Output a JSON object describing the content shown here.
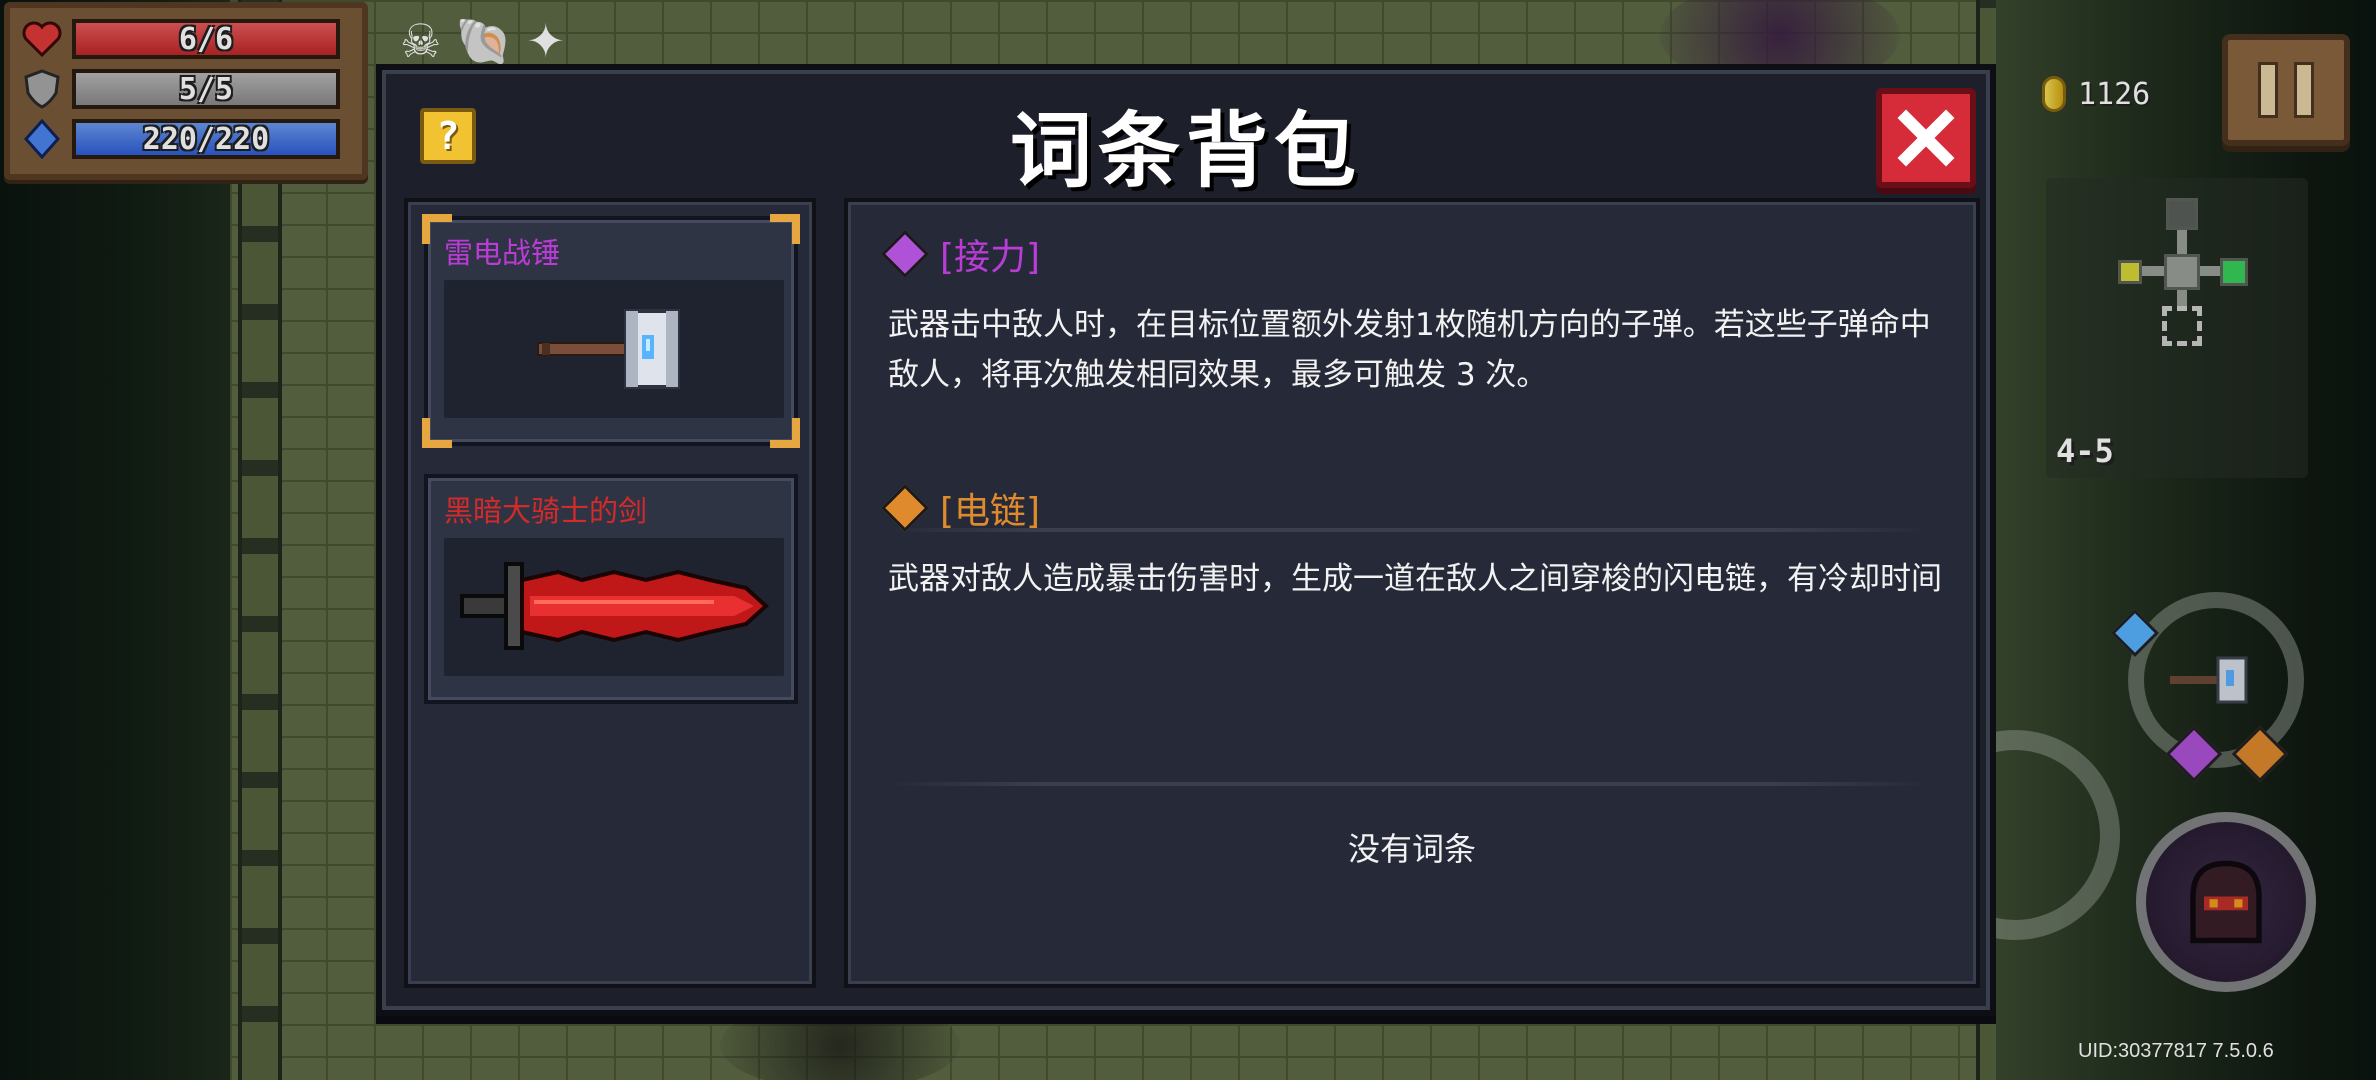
{
  "hud": {
    "hp": {
      "current": 6,
      "max": 6,
      "text": "6/6",
      "fill": 1.0,
      "icon": "heart-icon",
      "color": "#d63a3a"
    },
    "armor": {
      "current": 5,
      "max": 5,
      "text": "5/5",
      "fill": 1.0,
      "icon": "shield-icon",
      "color": "#9a9a9a"
    },
    "energy": {
      "current": 220,
      "max": 220,
      "text": "220/220",
      "fill": 1.0,
      "icon": "energy-crystal-icon",
      "color": "#3f6ee0"
    },
    "buffs": [
      "skull-buff-icon",
      "shell-buff-icon",
      "star-buff-icon"
    ],
    "coins": "1126",
    "level": "4-5",
    "uid": "UID:30377817 7.5.0.6"
  },
  "dialog": {
    "title": "词条背包",
    "help_label": "?",
    "weapons": [
      {
        "name": "雷电战锤",
        "name_color": "#b93cd6",
        "selected": true,
        "image": "thunder-hammer-icon"
      },
      {
        "name": "黑暗大骑士的剑",
        "name_color": "#d42a2a",
        "selected": false,
        "image": "dark-knight-sword-icon"
      }
    ],
    "affixes": [
      {
        "name": "[接力]",
        "color": "#b93cd6",
        "gem_color": "#b052d8",
        "icon": "purple-gem-icon",
        "description": "武器击中敌人时，在目标位置额外发射1枚随机方向的子弹。若这些子弹命中敌人，将再次触发相同效果，最多可触发 3 次。"
      },
      {
        "name": "[电链]",
        "color": "#e08a2e",
        "gem_color": "#e08a2e",
        "icon": "orange-gem-icon",
        "description": "武器对敌人造成暴击伤害时，生成一道在敌人之间穿梭的闪电链，有冷却时间"
      }
    ],
    "empty_text": "没有词条"
  }
}
